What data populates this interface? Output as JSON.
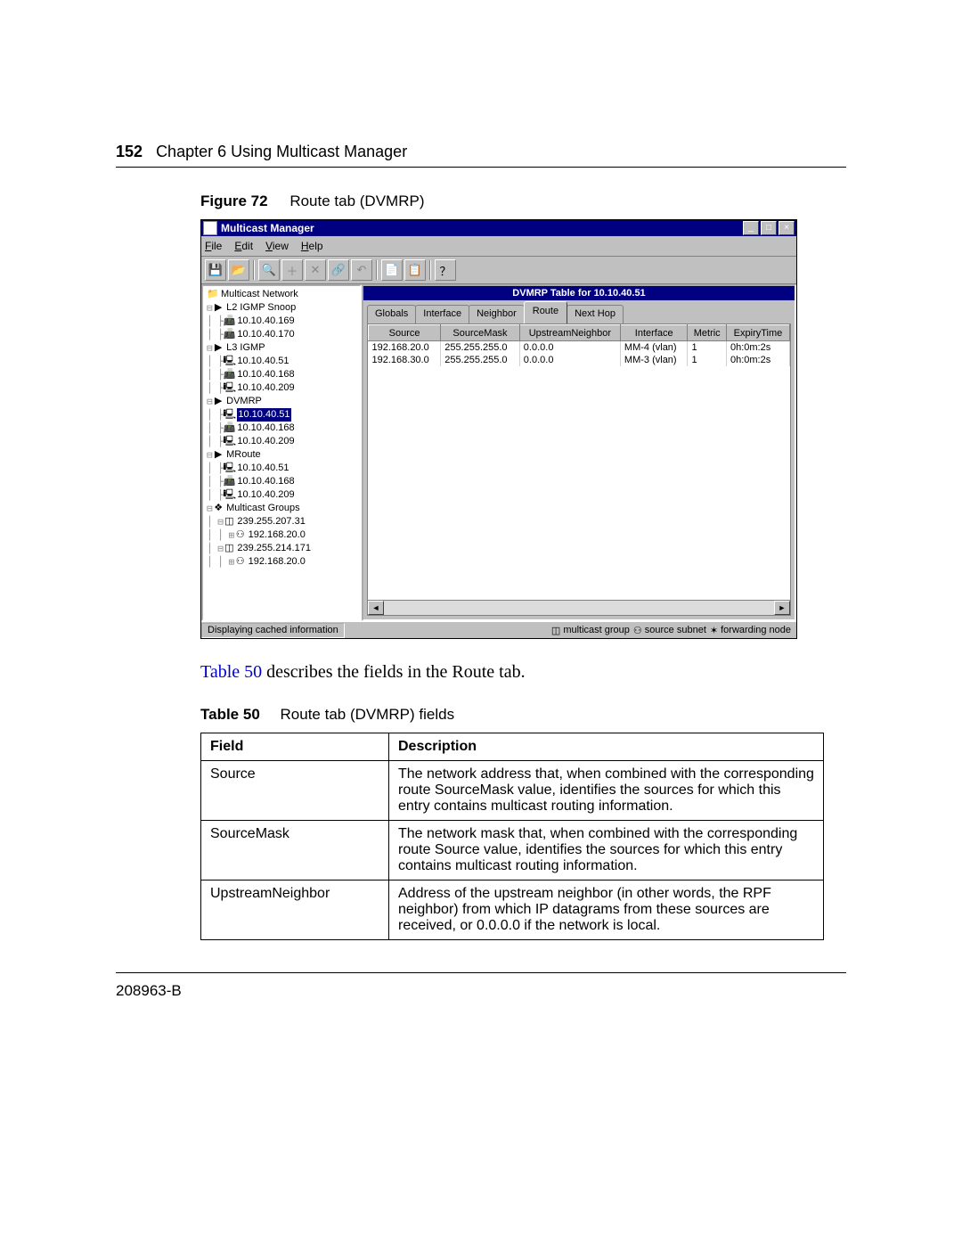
{
  "page": {
    "number": "152",
    "chapter": "Chapter 6  Using Multicast Manager",
    "footer": "208963-B"
  },
  "figure": {
    "label": "Figure 72",
    "caption": "Route tab (DVMRP)"
  },
  "body_text_before_link": "",
  "body_link": "Table 50",
  "body_text_after_link": " describes the fields in the Route tab.",
  "table_caption": {
    "label": "Table 50",
    "caption": "Route tab (DVMRP) fields"
  },
  "desc_table": {
    "headers": [
      "Field",
      "Description"
    ],
    "rows": [
      {
        "field": "Source",
        "desc": "The network address that, when combined with the corresponding route SourceMask value, identifies the sources for which this entry contains multicast routing information."
      },
      {
        "field": "SourceMask",
        "desc": "The network mask that, when combined with the corresponding route Source value, identifies the sources for which this entry contains multicast routing information."
      },
      {
        "field": "UpstreamNeighbor",
        "desc": "Address of the upstream neighbor (in other words, the RPF neighbor) from which IP datagrams from these sources are received, or 0.0.0.0 if the network is local."
      }
    ]
  },
  "window": {
    "title": "Multicast Manager",
    "menus": [
      "File",
      "Edit",
      "View",
      "Help"
    ],
    "toolbar_icons": [
      "save-icon",
      "open-icon",
      "search-icon",
      "plus-icon",
      "delete-icon",
      "link-icon",
      "back-icon",
      "copy-icon",
      "paste-icon",
      "help-icon"
    ],
    "table_header": "DVMRP Table for 10.10.40.51",
    "tabs": [
      "Globals",
      "Interface",
      "Neighbor",
      "Route",
      "Next Hop"
    ],
    "active_tab": "Route",
    "grid_headers": [
      "Source",
      "SourceMask",
      "UpstreamNeighbor",
      "Interface",
      "Metric",
      "ExpiryTime"
    ],
    "grid_rows": [
      [
        "192.168.20.0",
        "255.255.255.0",
        "0.0.0.0",
        "MM-4 (vlan)",
        "1",
        "0h:0m:2s"
      ],
      [
        "192.168.30.0",
        "255.255.255.0",
        "0.0.0.0",
        "MM-3 (vlan)",
        "1",
        "0h:0m:2s"
      ]
    ],
    "status_text": "Displaying cached information",
    "legend": [
      "multicast group",
      "source subnet",
      "forwarding node"
    ],
    "tree_root": "Multicast Network",
    "tree": [
      {
        "lvl": 0,
        "exp": "-",
        "icon": "▶",
        "label": "L2 IGMP Snoop"
      },
      {
        "lvl": 1,
        "exp": "",
        "icon": "📠",
        "label": "10.10.40.169"
      },
      {
        "lvl": 1,
        "exp": "",
        "icon": "📠",
        "label": "10.10.40.170"
      },
      {
        "lvl": 0,
        "exp": "-",
        "icon": "▶",
        "label": "L3 IGMP"
      },
      {
        "lvl": 1,
        "exp": "",
        "icon": "🖳",
        "label": "10.10.40.51"
      },
      {
        "lvl": 1,
        "exp": "",
        "icon": "📠",
        "label": "10.10.40.168"
      },
      {
        "lvl": 1,
        "exp": "",
        "icon": "🖳",
        "label": "10.10.40.209"
      },
      {
        "lvl": 0,
        "exp": "-",
        "icon": "▶",
        "label": "DVMRP"
      },
      {
        "lvl": 1,
        "exp": "",
        "icon": "🖳",
        "label": "10.10.40.51",
        "sel": true
      },
      {
        "lvl": 1,
        "exp": "",
        "icon": "📠",
        "label": "10.10.40.168"
      },
      {
        "lvl": 1,
        "exp": "",
        "icon": "🖳",
        "label": "10.10.40.209"
      },
      {
        "lvl": 0,
        "exp": "-",
        "icon": "▶",
        "label": "MRoute"
      },
      {
        "lvl": 1,
        "exp": "",
        "icon": "🖳",
        "label": "10.10.40.51"
      },
      {
        "lvl": 1,
        "exp": "",
        "icon": "📠",
        "label": "10.10.40.168"
      },
      {
        "lvl": 1,
        "exp": "",
        "icon": "🖳",
        "label": "10.10.40.209"
      },
      {
        "lvl": 0,
        "exp": "-",
        "icon": "❖",
        "label": "Multicast Groups"
      },
      {
        "lvl": 1,
        "exp": "-",
        "icon": "◫",
        "label": "239.255.207.31"
      },
      {
        "lvl": 2,
        "exp": "+",
        "icon": "⚇",
        "label": "192.168.20.0"
      },
      {
        "lvl": 1,
        "exp": "-",
        "icon": "◫",
        "label": "239.255.214.171"
      },
      {
        "lvl": 2,
        "exp": "+",
        "icon": "⚇",
        "label": "192.168.20.0"
      }
    ]
  }
}
